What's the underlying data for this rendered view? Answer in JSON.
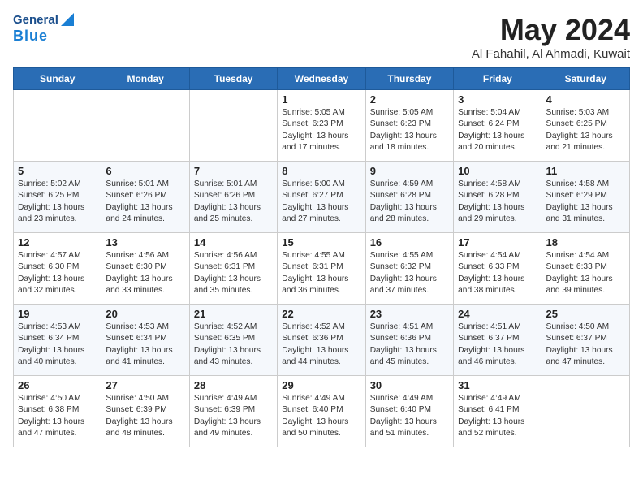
{
  "header": {
    "logo_general": "General",
    "logo_blue": "Blue",
    "title": "May 2024",
    "location": "Al Fahahil, Al Ahmadi, Kuwait"
  },
  "weekdays": [
    "Sunday",
    "Monday",
    "Tuesday",
    "Wednesday",
    "Thursday",
    "Friday",
    "Saturday"
  ],
  "weeks": [
    [
      {
        "day": "",
        "info": ""
      },
      {
        "day": "",
        "info": ""
      },
      {
        "day": "",
        "info": ""
      },
      {
        "day": "1",
        "info": "Sunrise: 5:05 AM\nSunset: 6:23 PM\nDaylight: 13 hours\nand 17 minutes."
      },
      {
        "day": "2",
        "info": "Sunrise: 5:05 AM\nSunset: 6:23 PM\nDaylight: 13 hours\nand 18 minutes."
      },
      {
        "day": "3",
        "info": "Sunrise: 5:04 AM\nSunset: 6:24 PM\nDaylight: 13 hours\nand 20 minutes."
      },
      {
        "day": "4",
        "info": "Sunrise: 5:03 AM\nSunset: 6:25 PM\nDaylight: 13 hours\nand 21 minutes."
      }
    ],
    [
      {
        "day": "5",
        "info": "Sunrise: 5:02 AM\nSunset: 6:25 PM\nDaylight: 13 hours\nand 23 minutes."
      },
      {
        "day": "6",
        "info": "Sunrise: 5:01 AM\nSunset: 6:26 PM\nDaylight: 13 hours\nand 24 minutes."
      },
      {
        "day": "7",
        "info": "Sunrise: 5:01 AM\nSunset: 6:26 PM\nDaylight: 13 hours\nand 25 minutes."
      },
      {
        "day": "8",
        "info": "Sunrise: 5:00 AM\nSunset: 6:27 PM\nDaylight: 13 hours\nand 27 minutes."
      },
      {
        "day": "9",
        "info": "Sunrise: 4:59 AM\nSunset: 6:28 PM\nDaylight: 13 hours\nand 28 minutes."
      },
      {
        "day": "10",
        "info": "Sunrise: 4:58 AM\nSunset: 6:28 PM\nDaylight: 13 hours\nand 29 minutes."
      },
      {
        "day": "11",
        "info": "Sunrise: 4:58 AM\nSunset: 6:29 PM\nDaylight: 13 hours\nand 31 minutes."
      }
    ],
    [
      {
        "day": "12",
        "info": "Sunrise: 4:57 AM\nSunset: 6:30 PM\nDaylight: 13 hours\nand 32 minutes."
      },
      {
        "day": "13",
        "info": "Sunrise: 4:56 AM\nSunset: 6:30 PM\nDaylight: 13 hours\nand 33 minutes."
      },
      {
        "day": "14",
        "info": "Sunrise: 4:56 AM\nSunset: 6:31 PM\nDaylight: 13 hours\nand 35 minutes."
      },
      {
        "day": "15",
        "info": "Sunrise: 4:55 AM\nSunset: 6:31 PM\nDaylight: 13 hours\nand 36 minutes."
      },
      {
        "day": "16",
        "info": "Sunrise: 4:55 AM\nSunset: 6:32 PM\nDaylight: 13 hours\nand 37 minutes."
      },
      {
        "day": "17",
        "info": "Sunrise: 4:54 AM\nSunset: 6:33 PM\nDaylight: 13 hours\nand 38 minutes."
      },
      {
        "day": "18",
        "info": "Sunrise: 4:54 AM\nSunset: 6:33 PM\nDaylight: 13 hours\nand 39 minutes."
      }
    ],
    [
      {
        "day": "19",
        "info": "Sunrise: 4:53 AM\nSunset: 6:34 PM\nDaylight: 13 hours\nand 40 minutes."
      },
      {
        "day": "20",
        "info": "Sunrise: 4:53 AM\nSunset: 6:34 PM\nDaylight: 13 hours\nand 41 minutes."
      },
      {
        "day": "21",
        "info": "Sunrise: 4:52 AM\nSunset: 6:35 PM\nDaylight: 13 hours\nand 43 minutes."
      },
      {
        "day": "22",
        "info": "Sunrise: 4:52 AM\nSunset: 6:36 PM\nDaylight: 13 hours\nand 44 minutes."
      },
      {
        "day": "23",
        "info": "Sunrise: 4:51 AM\nSunset: 6:36 PM\nDaylight: 13 hours\nand 45 minutes."
      },
      {
        "day": "24",
        "info": "Sunrise: 4:51 AM\nSunset: 6:37 PM\nDaylight: 13 hours\nand 46 minutes."
      },
      {
        "day": "25",
        "info": "Sunrise: 4:50 AM\nSunset: 6:37 PM\nDaylight: 13 hours\nand 47 minutes."
      }
    ],
    [
      {
        "day": "26",
        "info": "Sunrise: 4:50 AM\nSunset: 6:38 PM\nDaylight: 13 hours\nand 47 minutes."
      },
      {
        "day": "27",
        "info": "Sunrise: 4:50 AM\nSunset: 6:39 PM\nDaylight: 13 hours\nand 48 minutes."
      },
      {
        "day": "28",
        "info": "Sunrise: 4:49 AM\nSunset: 6:39 PM\nDaylight: 13 hours\nand 49 minutes."
      },
      {
        "day": "29",
        "info": "Sunrise: 4:49 AM\nSunset: 6:40 PM\nDaylight: 13 hours\nand 50 minutes."
      },
      {
        "day": "30",
        "info": "Sunrise: 4:49 AM\nSunset: 6:40 PM\nDaylight: 13 hours\nand 51 minutes."
      },
      {
        "day": "31",
        "info": "Sunrise: 4:49 AM\nSunset: 6:41 PM\nDaylight: 13 hours\nand 52 minutes."
      },
      {
        "day": "",
        "info": ""
      }
    ]
  ]
}
